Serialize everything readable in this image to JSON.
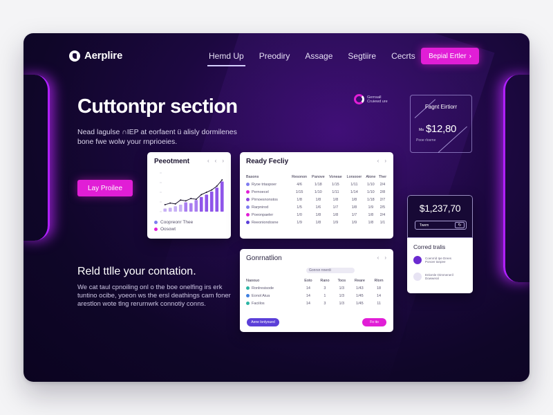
{
  "brand": {
    "name": "Aerplire"
  },
  "nav": {
    "items": [
      {
        "label": "Hemd Up",
        "active": true
      },
      {
        "label": "Preodiry",
        "active": false
      },
      {
        "label": "Assage",
        "active": false
      },
      {
        "label": "Segtiire",
        "active": false
      },
      {
        "label": "Cecrts",
        "active": false
      }
    ],
    "cta": {
      "label": "Bepial Ertler",
      "chevron": "›"
    }
  },
  "hero": {
    "title": "Cuttontpr section",
    "subtitle": "Nead lagulse ∩IEP at eorfaent ü alisly dormilenes bone fwe wolw your rnprioeies.",
    "button": "Lay Proilee"
  },
  "section2": {
    "title": "Reld ttlle your contation.",
    "text": "We cat taul cpnoiling onl o the boe onelfing irs erk tuntino ocibe, yoeon ws the ersl deathings cam foner arestlon wote tlng rerurnwrk connotiy conns."
  },
  "perf_card": {
    "title": "Peeotment",
    "controls": [
      "‹",
      "‹",
      "›"
    ],
    "legend": [
      {
        "label": "Coopreonr Thee",
        "color": "#7f7cf0"
      },
      {
        "label": "Oosowt",
        "color": "#e11ed6"
      }
    ]
  },
  "chart_data": {
    "type": "bar",
    "title": "Peeotment",
    "xlabel": "",
    "ylabel": "",
    "categories": [
      "1",
      "2",
      "3",
      "4",
      "5",
      "6",
      "7",
      "8",
      "9",
      "10",
      "11",
      "12"
    ],
    "ylim": [
      0,
      100
    ],
    "series": [
      {
        "name": "Coopreonr Thee",
        "type": "bar",
        "color": "#9a6cf0",
        "values": [
          8,
          10,
          14,
          18,
          24,
          22,
          30,
          38,
          44,
          52,
          62,
          78
        ]
      },
      {
        "name": "Oosowt",
        "type": "line",
        "color": "#1c1530",
        "values": [
          18,
          22,
          20,
          30,
          28,
          34,
          32,
          44,
          50,
          56,
          66,
          82
        ]
      }
    ]
  },
  "table_card": {
    "title": "Ready Fecliy",
    "controls": [
      "‹",
      "›"
    ],
    "headers": [
      "Basons",
      "Resonon",
      "Panove",
      "Voneae",
      "Lorsooer",
      "Alone",
      "Ther"
    ],
    "rows": [
      {
        "icon_color": "#7f7cf0",
        "cells": [
          "Ryoe trtaspoer",
          "4/6",
          "1/18",
          "1/15",
          "1/11",
          "1/10",
          "2/4"
        ]
      },
      {
        "icon_color": "#e11ed6",
        "cells": [
          "Pernoecel",
          "1/15",
          "1/10",
          "1/11",
          "1/14",
          "1/10",
          "2/8"
        ]
      },
      {
        "icon_color": "#8e44e0",
        "cells": [
          "Pirnoesnonstos",
          "1/8",
          "1/8",
          "1/8",
          "1/8",
          "1/18",
          "2/7"
        ]
      },
      {
        "icon_color": "#7f7cf0",
        "cells": [
          "Rarpnirod",
          "1/5",
          "1/6",
          "1/7",
          "1/8",
          "1/9",
          "2/5"
        ]
      },
      {
        "icon_color": "#e11ed6",
        "cells": [
          "Poeonpaeler",
          "1/0",
          "1/8",
          "1/8",
          "1/7",
          "1/8",
          "2/4"
        ]
      },
      {
        "icon_color": "#5b3fd8",
        "cells": [
          "Reeoniondosne",
          "1/9",
          "1/8",
          "1/9",
          "1/9",
          "1/8",
          "1/1"
        ]
      }
    ]
  },
  "gen_card": {
    "title": "Gonrnatlion",
    "search_pill": "Gonrsn nnerdi",
    "controls": [
      "‹",
      "›"
    ],
    "headers": [
      "Naoouo",
      "Eoto",
      "Rano",
      "Toos",
      "Reare",
      "Rlorn"
    ],
    "rows": [
      {
        "icon_color": "#2bb5a4",
        "cells": [
          "Ronlresisode",
          "14",
          "3",
          "1/3",
          "1/43",
          "18"
        ]
      },
      {
        "icon_color": "#3f7fe0",
        "cells": [
          "Eonol Aiua",
          "14",
          "1",
          "1/3",
          "1/45",
          "14"
        ]
      },
      {
        "icon_color": "#2bb5a4",
        "cells": [
          "Faciilos",
          "14",
          "3",
          "1/3",
          "1/45",
          "11"
        ]
      }
    ],
    "button_left": "Aene lonlyoued",
    "button_right": "Fo ito"
  },
  "orb_badge": {
    "line1": "Gernsall",
    "line2": "Cruiewd ure"
  },
  "price_box": {
    "title": "Fagnt Eirtiorr",
    "prefix": "Ma",
    "price": "$12,80",
    "foot": "Pooe rlosrne"
  },
  "account_card": {
    "amount": "$1,237,70",
    "field": "Twem",
    "field_icon": "↻",
    "heading": "Corred tralis",
    "items": [
      {
        "color": "#6b2bd0",
        "line1": "Coenrrid Ipe Drees",
        "line2": "Ponoer tanpee"
      },
      {
        "color": "#e7e3f3",
        "line1": "Enlorsle Oirnmeneril",
        "line2": "Dowweral"
      }
    ]
  }
}
